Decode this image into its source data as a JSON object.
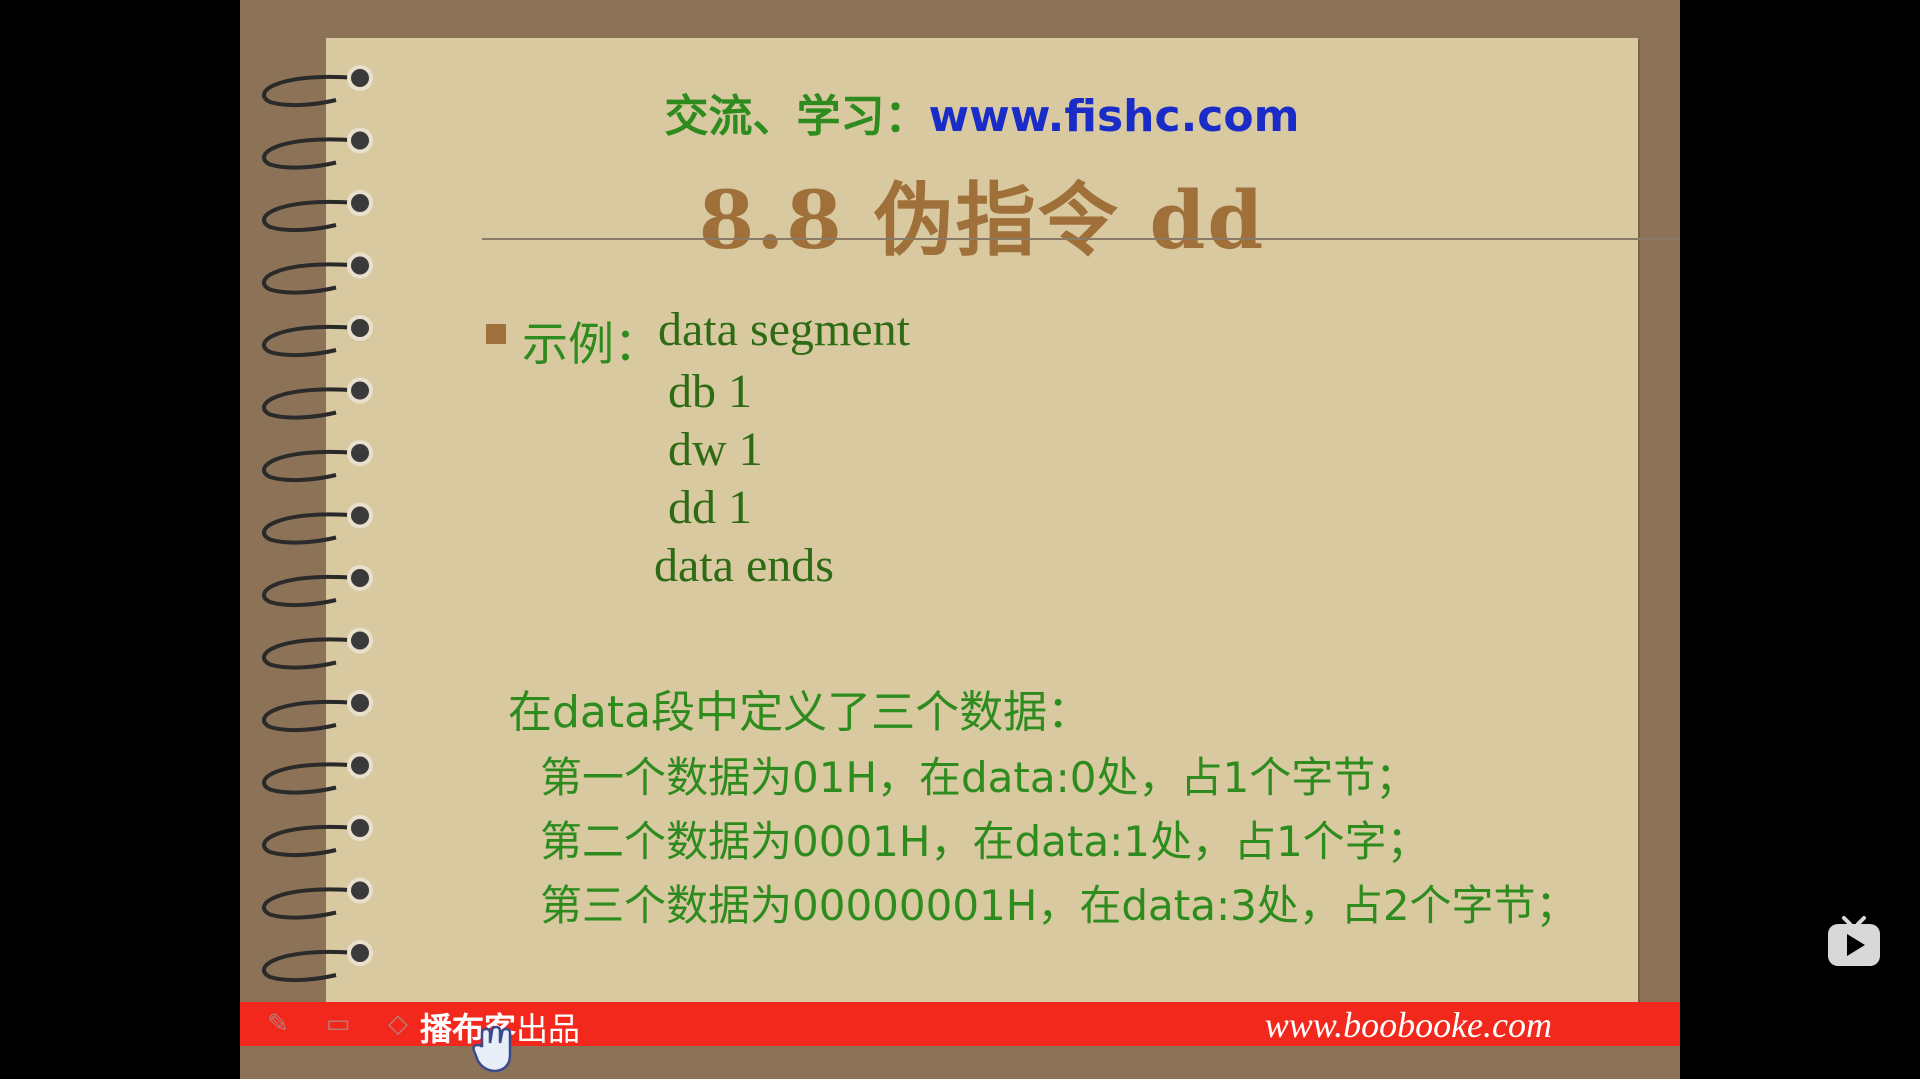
{
  "slide": {
    "site_label_cn": "交流、学习：",
    "site_url": "www.fishc.com",
    "title": "8.8 伪指令 dd",
    "example_label": "示例：",
    "code_lines": [
      "data segment",
      "db 1",
      "dw 1",
      "dd 1",
      "data ends"
    ],
    "heading": "在data段中定义了三个数据：",
    "items": [
      "第一个数据为01H，在data:0处，占1个字节；",
      "第二个数据为0001H，在data:1处，占1个字；",
      "第三个数据为00000001H，在data:3处，占2个字节；"
    ]
  },
  "footer": {
    "brand": "播布客",
    "brand_suffix": "出品",
    "url": "www.boobooke.com"
  },
  "colors": {
    "frame": "#8c7256",
    "paper": "#d9c9a0",
    "title": "#a0703a",
    "text_green": "#2e8b1e",
    "url_blue": "#1a2cc8",
    "footer_red": "#f2281c"
  },
  "icons": {
    "pen_tool": "pencil-icon",
    "slide_tool": "slide-icon",
    "eraser_tool": "eraser-icon",
    "cursor": "hand-cursor-icon",
    "player": "bilibili-play-icon"
  }
}
